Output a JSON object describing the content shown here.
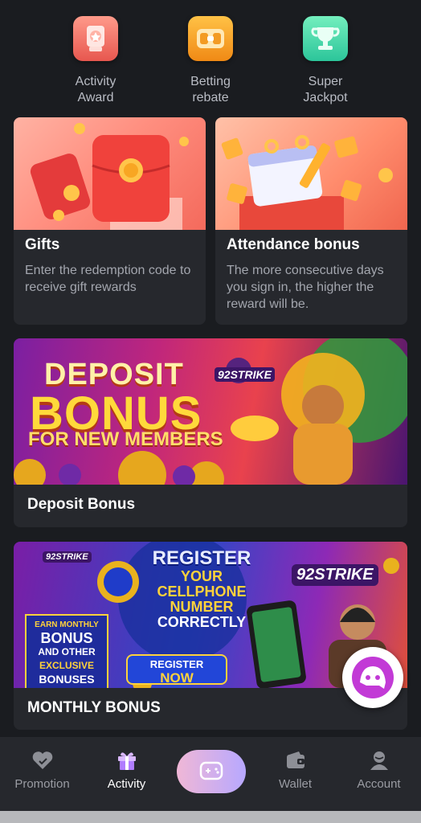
{
  "quick_actions": [
    {
      "label": "Activity\nAward",
      "line1": "Activity",
      "line2": "Award",
      "icon": "medal-icon",
      "color": "#e7574f"
    },
    {
      "label": "Betting\nrebate",
      "line1": "Betting",
      "line2": "rebate",
      "icon": "wallet-rebate-icon",
      "color": "#f08a15"
    },
    {
      "label": "Super\nJackpot",
      "line1": "Super",
      "line2": "Jackpot",
      "icon": "trophy-icon",
      "color": "#2cc59a"
    }
  ],
  "cards": {
    "gifts": {
      "title": "Gifts",
      "desc": "Enter the redemption code to receive gift rewards"
    },
    "attendance": {
      "title": "Attendance bonus",
      "desc": "The more consecutive days you sign in, the higher the reward will be."
    },
    "deposit": {
      "title": "Deposit Bonus",
      "banner": {
        "line1": "DEPOSIT",
        "line2": "BONUS",
        "line3": "FOR NEW MEMBERS",
        "brand": "92STRIKE"
      }
    },
    "monthly": {
      "title": "MONTHLY BONUS",
      "banner": {
        "headline1": "REGISTER",
        "headline2": "YOUR",
        "headline3": "CELLPHONE",
        "headline4": "NUMBER",
        "headline5": "CORRECTLY",
        "side1": "EARN MONTHLY",
        "side2": "BONUS",
        "side3": "AND OTHER",
        "side4": "EXCLUSIVE",
        "side5": "BONUSES",
        "cta1": "REGISTER",
        "cta2": "NOW",
        "brand": "92STRIKE"
      }
    }
  },
  "nav": {
    "items": [
      {
        "label": "Promotion",
        "icon": "promotion-icon",
        "active": false
      },
      {
        "label": "Activity",
        "icon": "gift-icon",
        "active": true
      },
      {
        "label": "",
        "icon": "game-controller-icon",
        "active": false
      },
      {
        "label": "Wallet",
        "icon": "wallet-icon",
        "active": false
      },
      {
        "label": "Account",
        "icon": "account-icon",
        "active": false
      }
    ]
  },
  "colors": {
    "background": "#1a1c20",
    "card": "#26282d",
    "text_muted": "#a3a6ae",
    "nav_center_gradient_start": "#f0b7d6",
    "nav_center_gradient_end": "#b7a8ff",
    "chat_accent": "#c23ad6"
  }
}
